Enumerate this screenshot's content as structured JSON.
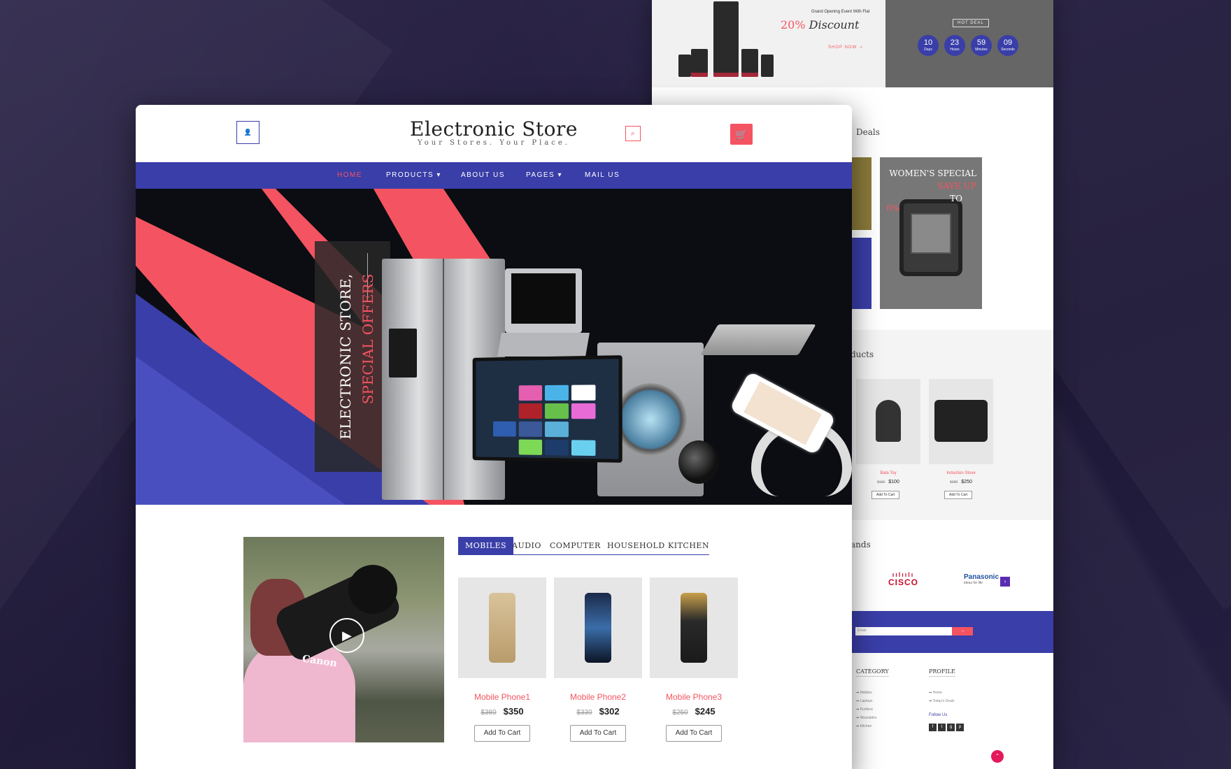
{
  "colors": {
    "primary": "#3a3ea8",
    "accent": "#f45461",
    "background": "#221c3d"
  },
  "header": {
    "title": "Electronic Store",
    "tagline": "Your Stores. Your Place.",
    "user_icon": "user-icon",
    "search_icon": "search-icon",
    "cart_icon": "cart-icon"
  },
  "nav": {
    "items": [
      "HOME",
      "PRODUCTS",
      "ABOUT US",
      "PAGES",
      "MAIL US"
    ],
    "active": "HOME"
  },
  "hero": {
    "line1": "ELECTRONIC STORE,",
    "line2": "SPECIAL OFFERS"
  },
  "tabs": {
    "items": [
      "MOBILES",
      "AUDIO",
      "COMPUTER",
      "HOUSEHOLD",
      "KITCHEN"
    ],
    "active": "MOBILES"
  },
  "products": [
    {
      "name": "Mobile Phone1",
      "old_price": "$380",
      "price": "$350",
      "button": "Add To Cart"
    },
    {
      "name": "Mobile Phone2",
      "old_price": "$330",
      "price": "$302",
      "button": "Add To Cart"
    },
    {
      "name": "Mobile Phone3",
      "old_price": "$250",
      "price": "$245",
      "button": "Add To Cart"
    }
  ],
  "video": {
    "brand_text": "Canon"
  },
  "back_page": {
    "banner": {
      "small": "Grand Opening Event With Flat",
      "discount_pct": "20%",
      "discount_word": "Discount",
      "shop": "SHOP NOW",
      "hot": "HOT DEAL"
    },
    "timer": [
      {
        "value": "10",
        "unit": "Days"
      },
      {
        "value": "23",
        "unit": "Hours"
      },
      {
        "value": "59",
        "unit": "Minutes"
      },
      {
        "value": "09",
        "unit": "Seconds"
      }
    ],
    "deals_title": "Deals",
    "womens": {
      "l1": "WOMEN'S SPECIAL",
      "l2": "SAVE UP",
      "l3": "TO",
      "l4": "0%"
    },
    "products_title": "ducts",
    "small_products": [
      {
        "name": "Bata Toy",
        "old_price": "$150",
        "price": "$100",
        "button": "Add To Cart"
      },
      {
        "name": "Induction Stove",
        "old_price": "$280",
        "price": "$250",
        "button": "Add To Cart"
      }
    ],
    "brands_title": "ands",
    "brands": [
      {
        "name": "CISCO"
      },
      {
        "name": "Panasonic",
        "sub": "ideas for life"
      }
    ],
    "newsletter": {
      "placeholder": "Email",
      "button": "→"
    },
    "footer": {
      "category_title": "CATEGORY",
      "category_items": [
        "Mobiles",
        "Laptops",
        "Purifiers",
        "Wearables",
        "Kitchen"
      ],
      "profile_title": "PROFILE",
      "profile_items": [
        "Home",
        "Today's Deals"
      ],
      "follow": "Follow Us"
    }
  }
}
